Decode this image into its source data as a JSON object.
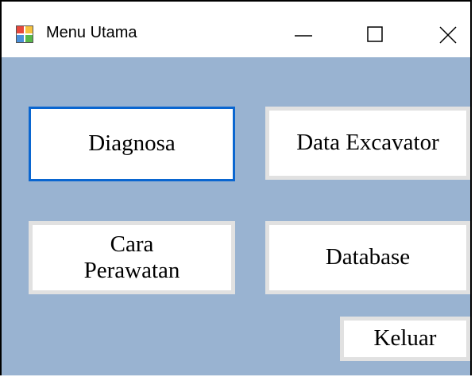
{
  "window": {
    "title": "Menu Utama",
    "controls": {
      "minimize_icon": "minimize-icon",
      "maximize_icon": "maximize-icon",
      "close_icon": "close-icon"
    },
    "background_color": "#99b3d1"
  },
  "buttons": {
    "diagnosa": "Diagnosa",
    "data_excavator": "Data Excavator",
    "cara_perawatan": "Cara\nPerawatan",
    "database": "Database",
    "keluar": "Keluar"
  },
  "focus_color": "#0a66d0"
}
